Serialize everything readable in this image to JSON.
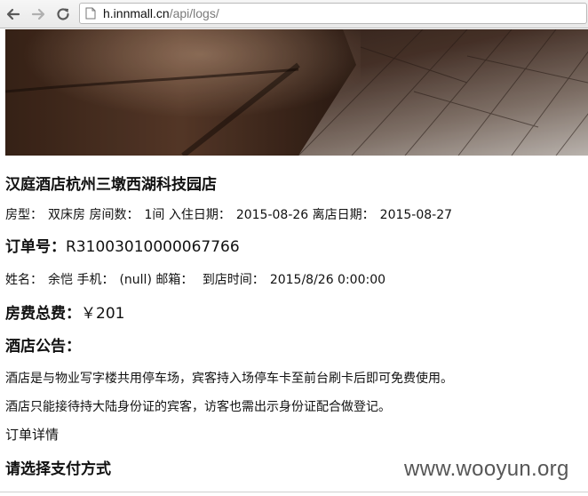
{
  "browser": {
    "url_host": "h.innmall.cn",
    "url_path": "/api/logs/"
  },
  "hotel": {
    "name": "汉庭酒店杭州三墩西湖科技园店"
  },
  "room": {
    "type_label": "房型：",
    "type_value": "双床房",
    "count_label": "房间数：",
    "count_value": "1间",
    "checkin_label": "入住日期：",
    "checkin_value": "2015-08-26",
    "checkout_label": "离店日期：",
    "checkout_value": "2015-08-27"
  },
  "order": {
    "number_label": "订单号：",
    "number_value": "R31003010000067766"
  },
  "guest": {
    "name_label": "姓名：",
    "name_value": "余恺",
    "phone_label": "手机：",
    "phone_value": "(null)",
    "email_label": "邮箱：",
    "arrival_label": "到店时间：",
    "arrival_value": "2015/8/26 0:00:00"
  },
  "fee": {
    "total_label": "房费总费：",
    "total_value": "￥201"
  },
  "notice": {
    "title": "酒店公告：",
    "line1": "酒店是与物业写字楼共用停车场，宾客持入场停车卡至前台刷卡后即可免费使用。",
    "line2": "酒店只能接待持大陆身份证的宾客，访客也需出示身份证配合做登记。"
  },
  "links": {
    "order_detail": "订单详情"
  },
  "payment": {
    "title": "请选择支付方式"
  },
  "watermark": "www.wooyun.org"
}
